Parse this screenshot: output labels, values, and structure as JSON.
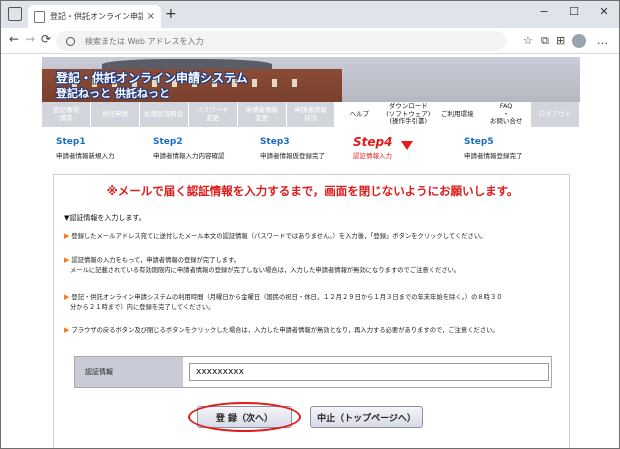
{
  "browser": {
    "tab_title": "登記・供託オンライン申請システム - ",
    "tab_close": "×",
    "new_tab": "+",
    "minimize": "−",
    "maximize": "☐",
    "close": "✕",
    "back": "←",
    "forward": "→",
    "reload": "⟳",
    "address_placeholder": "検索または Web アドレスを入力",
    "star": "☆",
    "collections": "⧉",
    "fav_bar": "⊞",
    "more": "…"
  },
  "banner": {
    "title": "登記・供託オンライン申請システム",
    "subtitle": "登記ねっと 供託ねっと"
  },
  "menu": [
    {
      "label": "登記事項\n請求",
      "state": "dim"
    },
    {
      "label": "供託申請",
      "state": "dim"
    },
    {
      "label": "処理状況照会",
      "state": "dim"
    },
    {
      "label": "パスワード\n変更",
      "state": "dim"
    },
    {
      "label": "申請者情報\n変更",
      "state": "dim"
    },
    {
      "label": "申請者情報\n抹消",
      "state": "dim"
    },
    {
      "label": "ヘルプ",
      "state": "act"
    },
    {
      "label": "ダウンロード\n(ソフトウェア)\n(操作手引書)",
      "state": "act"
    },
    {
      "label": "ご利用環境",
      "state": "act"
    },
    {
      "label": "FAQ\n・\nお問い合せ",
      "state": "act"
    },
    {
      "label": "ログアウト",
      "state": "dim"
    }
  ],
  "steps": [
    {
      "num": "Step1",
      "label": "申請者情報新規入力"
    },
    {
      "num": "Step2",
      "label": "申請者情報入力内容確認"
    },
    {
      "num": "Step3",
      "label": "申請者情報仮登録完了"
    },
    {
      "num": "Step4",
      "label": "認証情報入力"
    },
    {
      "num": "Step5",
      "label": "申請者情報登録完了"
    }
  ],
  "main": {
    "warning": "※メールで届く認証情報を入力するまで，画面を閉じないようにお願いします。",
    "intro": "▼認証情報を入力します。",
    "bullets": [
      [
        "登録したメールアドレス宛てに送付したメール本文の認証情報（パスワードではありません。）を入力後，「登録」ボタンをクリックしてください。"
      ],
      [
        "認証情報の入力をもって，申請者情報の登録が完了します。",
        "メールに記載されている有効期限内に申請者情報の登録が完了しない場合は，入力した申請者情報が無効になりますのでご注意ください。"
      ],
      [
        "登記・供託オンライン申請システムの利用時間（月曜日から金曜日（国民の祝日・休日，１２月２９日から１月３日までの年末年始を除く。）の８時３０",
        "分から２１時まで）内に登録を完了してください。"
      ],
      [
        "ブラウザの戻るボタン及び閉じるボタンをクリックした場合は，入力した申請者情報が無効となり，再入力する必要がありますので，ご注意ください。"
      ]
    ],
    "form_label": "認証情報",
    "form_value": "xxxxxxxxx",
    "register_button": "登 録（次へ）",
    "cancel_button": "中止（トップページへ）"
  }
}
